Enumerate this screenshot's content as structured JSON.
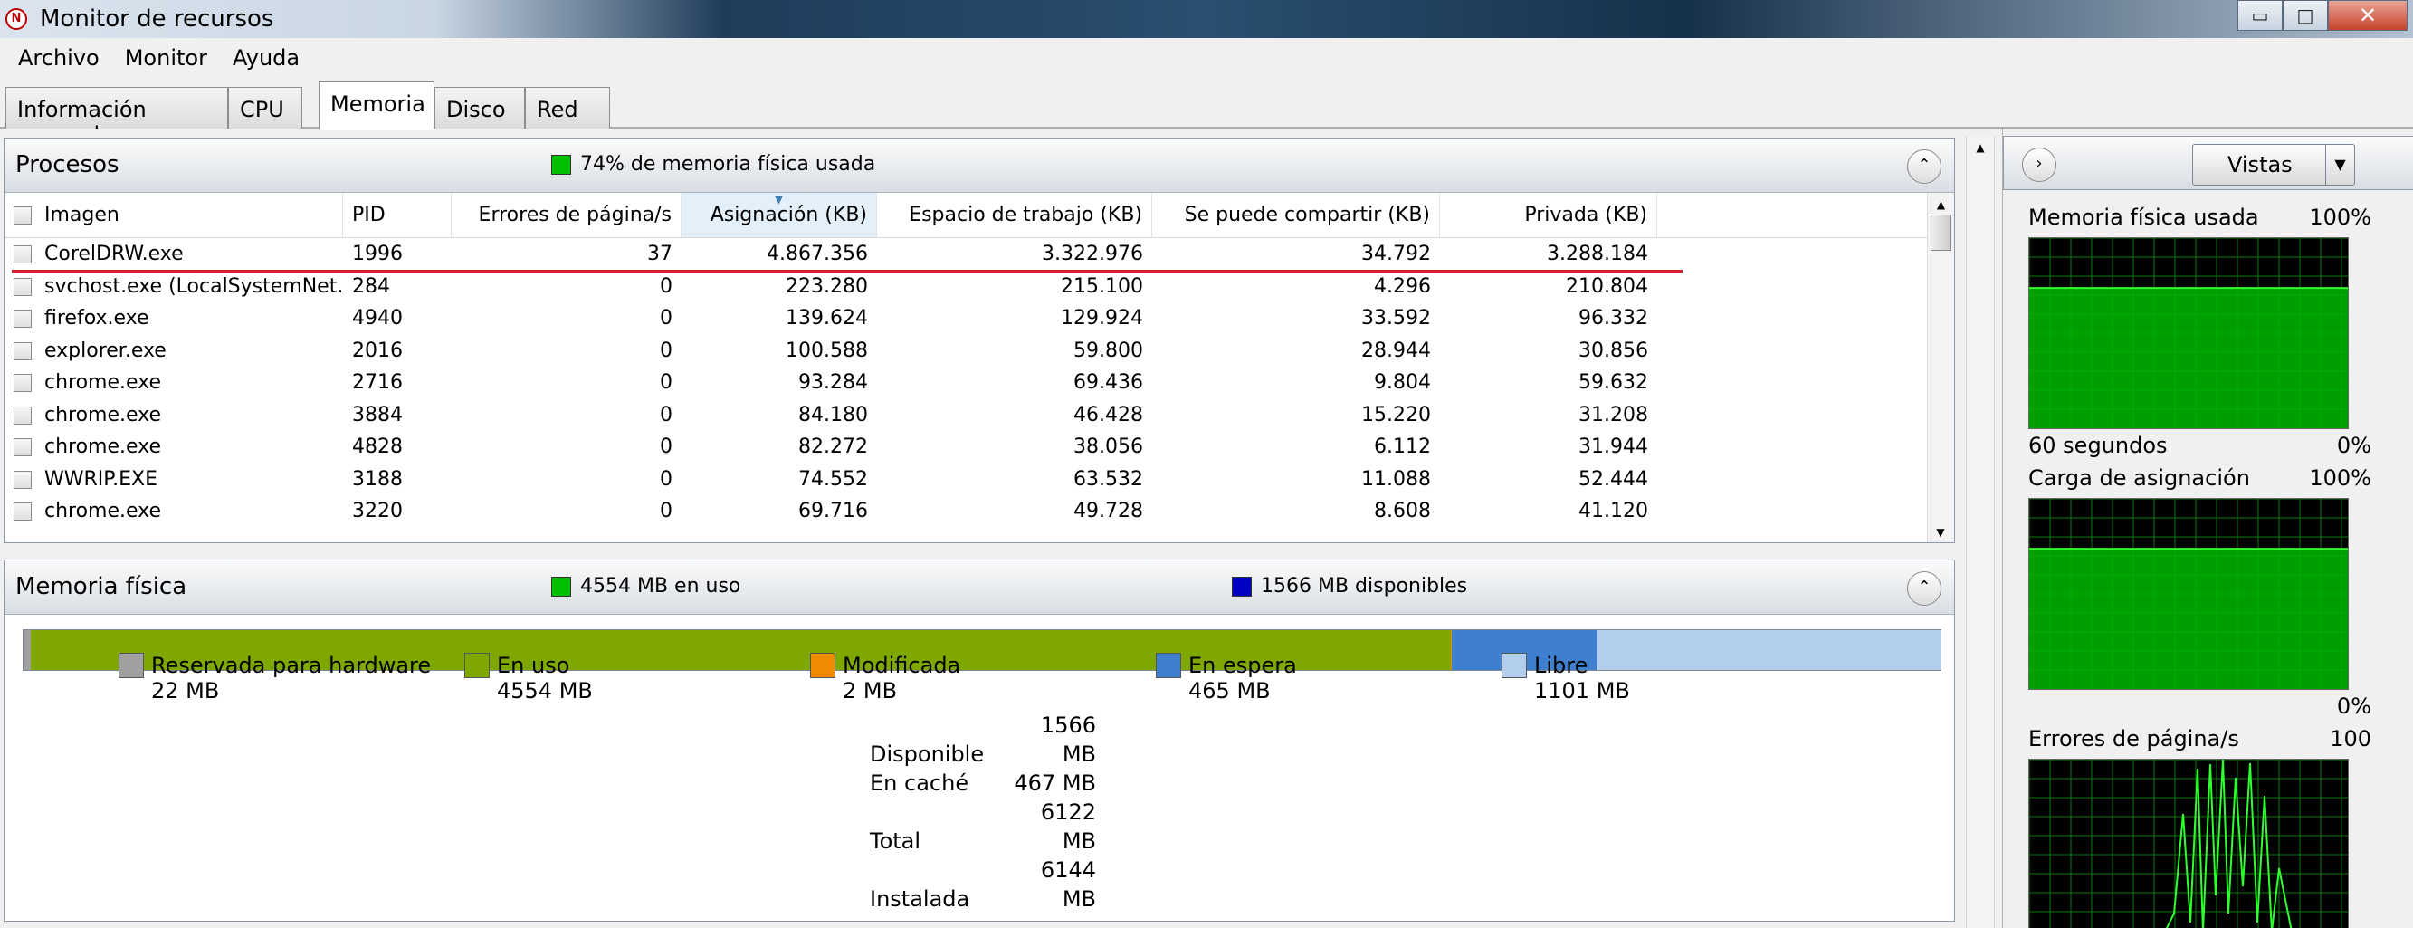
{
  "window": {
    "title": "Monitor de recursos",
    "minimize": "▭",
    "maximize": "□",
    "close": "✕"
  },
  "menu": [
    "Archivo",
    "Monitor",
    "Ayuda"
  ],
  "tabs": [
    "Información general",
    "CPU",
    "Memoria",
    "Disco",
    "Red"
  ],
  "active_tab": "Memoria",
  "processes": {
    "title": "Procesos",
    "summary": "74% de memoria física usada",
    "summary_color": "#00c000",
    "columns": [
      "Imagen",
      "PID",
      "Errores de página/s",
      "Asignación (KB)",
      "Espacio de trabajo (KB)",
      "Se puede compartir (KB)",
      "Privada (KB)"
    ],
    "sorted_column": "Asignación (KB)",
    "rows": [
      {
        "image": "CorelDRW.exe",
        "pid": "1996",
        "faults": "37",
        "commit": "4.867.356",
        "working": "3.322.976",
        "shareable": "34.792",
        "private": "3.288.184"
      },
      {
        "image": "svchost.exe (LocalSystemNet...",
        "pid": "284",
        "faults": "0",
        "commit": "223.280",
        "working": "215.100",
        "shareable": "4.296",
        "private": "210.804"
      },
      {
        "image": "firefox.exe",
        "pid": "4940",
        "faults": "0",
        "commit": "139.624",
        "working": "129.924",
        "shareable": "33.592",
        "private": "96.332"
      },
      {
        "image": "explorer.exe",
        "pid": "2016",
        "faults": "0",
        "commit": "100.588",
        "working": "59.800",
        "shareable": "28.944",
        "private": "30.856"
      },
      {
        "image": "chrome.exe",
        "pid": "2716",
        "faults": "0",
        "commit": "93.284",
        "working": "69.436",
        "shareable": "9.804",
        "private": "59.632"
      },
      {
        "image": "chrome.exe",
        "pid": "3884",
        "faults": "0",
        "commit": "84.180",
        "working": "46.428",
        "shareable": "15.220",
        "private": "31.208"
      },
      {
        "image": "chrome.exe",
        "pid": "4828",
        "faults": "0",
        "commit": "82.272",
        "working": "38.056",
        "shareable": "6.112",
        "private": "31.944"
      },
      {
        "image": "WWRIP.EXE",
        "pid": "3188",
        "faults": "0",
        "commit": "74.552",
        "working": "63.532",
        "shareable": "11.088",
        "private": "52.444"
      },
      {
        "image": "chrome.exe",
        "pid": "3220",
        "faults": "0",
        "commit": "69.716",
        "working": "49.728",
        "shareable": "8.608",
        "private": "41.120"
      }
    ]
  },
  "physical_memory": {
    "title": "Memoria física",
    "in_use_summary": "4554 MB en uso",
    "available_summary": "1566 MB disponibles",
    "in_use_color": "#00c000",
    "available_color": "#0000c0",
    "segments": [
      {
        "label": "Reservada para hardware",
        "value": "22 MB",
        "mb": 22,
        "color": "#a0a0a0"
      },
      {
        "label": "En uso",
        "value": "4554 MB",
        "mb": 4554,
        "color": "#7ea800"
      },
      {
        "label": "Modificada",
        "value": "2 MB",
        "mb": 2,
        "color": "#f08a00"
      },
      {
        "label": "En espera",
        "value": "465 MB",
        "mb": 465,
        "color": "#3e7fcf"
      },
      {
        "label": "Libre",
        "value": "1101 MB",
        "mb": 1101,
        "color": "#b3cdec"
      }
    ],
    "stats": [
      {
        "key": "Disponible",
        "value": "1566 MB"
      },
      {
        "key": "En caché",
        "value": "467 MB"
      },
      {
        "key": "Total",
        "value": "6122 MB"
      },
      {
        "key": "Instalada",
        "value": "6144 MB"
      }
    ]
  },
  "right_pane": {
    "views_label": "Vistas",
    "graphs": [
      {
        "title": "Memoria física usada",
        "max": "100%",
        "min": "0%",
        "footer": "60 segundos",
        "level": 0.74
      },
      {
        "title": "Carga de asignación",
        "max": "100%",
        "min": "0%",
        "footer": "",
        "level": 0.74
      },
      {
        "title": "Errores de página/s",
        "max": "100",
        "min": "",
        "footer": "",
        "level": 0
      }
    ]
  }
}
